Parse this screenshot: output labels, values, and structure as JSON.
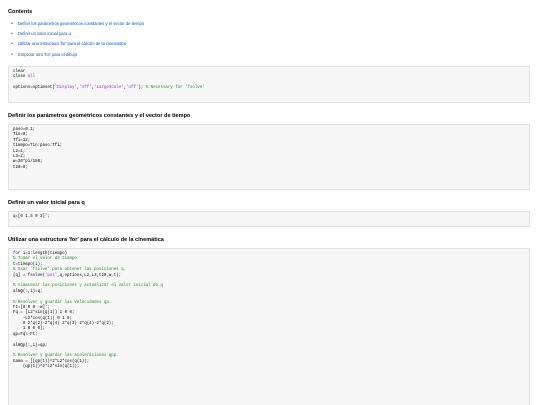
{
  "contents": {
    "title": "Contents",
    "items": [
      "Definir los parámetros geométricos constantes y el vector de tiempo",
      "Definir un valor inicial para q",
      "Utilizar una estructura 'for' para el cálculo de la cinemática",
      "Empezar otro 'for' para el dibujo"
    ]
  },
  "block1": {
    "lines": [
      [
        {
          "t": "clear",
          "c": ""
        }
      ],
      [
        {
          "t": "close ",
          "c": ""
        },
        {
          "t": "all",
          "c": "str"
        }
      ],
      [],
      [
        {
          "t": "options=optimset(",
          "c": ""
        },
        {
          "t": "'Display'",
          "c": "str"
        },
        {
          "t": ",",
          "c": ""
        },
        {
          "t": "'off'",
          "c": "str"
        },
        {
          "t": ",",
          "c": ""
        },
        {
          "t": "'LargeScale'",
          "c": "str"
        },
        {
          "t": ",",
          "c": ""
        },
        {
          "t": "'off'",
          "c": "str"
        },
        {
          "t": "); ",
          "c": ""
        },
        {
          "t": "% Necessary for 'fsolve'",
          "c": "cm"
        }
      ]
    ]
  },
  "section2": {
    "title": "Definir los parámetros geométricos constantes y el vector de tiempo",
    "lines": [
      [
        {
          "t": "paso=0.1;",
          "c": ""
        }
      ],
      [
        {
          "t": "Tin=0;",
          "c": ""
        }
      ],
      [
        {
          "t": "Tfi=12;",
          "c": ""
        }
      ],
      [
        {
          "t": "tiempo=Tin:paso:Tfi;",
          "c": ""
        }
      ],
      [
        {
          "t": "L2=1;",
          "c": ""
        }
      ],
      [
        {
          "t": "L3=2;",
          "c": ""
        }
      ],
      [
        {
          "t": "w=30*pi/180;",
          "c": ""
        }
      ],
      [
        {
          "t": "t20=0;",
          "c": ""
        }
      ]
    ]
  },
  "section3": {
    "title": "Definir un valor inicial para q",
    "lines": [
      [
        {
          "t": "q=[0 1.5 0 3]';",
          "c": ""
        }
      ]
    ]
  },
  "section4": {
    "title": "Utilizar una estructura 'for' para el cálculo de la cinemática",
    "lines": [
      [
        {
          "t": "for",
          "c": "kw"
        },
        {
          "t": " i=1:length(tiempo)",
          "c": ""
        }
      ],
      [
        {
          "t": "% Tomar el valor de tiempo",
          "c": "cm"
        }
      ],
      [
        {
          "t": "t=tiempo(i);",
          "c": ""
        }
      ],
      [
        {
          "t": "% Usar 'fsolve' para obtener las posiciones q.",
          "c": "cm"
        }
      ],
      [
        {
          "t": "[q] = fsolve(",
          "c": ""
        },
        {
          "t": "'pos'",
          "c": "str"
        },
        {
          "t": ",q,options,L2,L3,t20,w,t);",
          "c": ""
        }
      ],
      [],
      [
        {
          "t": "% Almacenar las posiciones y actualizar el valor inicial de q",
          "c": "cm"
        }
      ],
      [
        {
          "t": "almQ(:,i)=q;",
          "c": ""
        }
      ],
      [],
      [
        {
          "t": "% Resolver y guardar las velocidades qp",
          "c": "cm"
        }
      ],
      [
        {
          "t": "Ft=[0 0 0 -w]';",
          "c": ""
        }
      ],
      [
        {
          "t": "Fq = [L2*sin(q(1)) 1 0 0;",
          "c": ""
        }
      ],
      [
        {
          "t": "    -L2*cos(q(1)) 0 1 0;",
          "c": ""
        }
      ],
      [
        {
          "t": "    0 2*q(2)-2*q(4) 2*q(3) 2*q(4)-2*q(2);",
          "c": ""
        }
      ],
      [
        {
          "t": "    1 0 0 0];",
          "c": ""
        }
      ],
      [
        {
          "t": "qp=Fq\\-Ft;",
          "c": ""
        }
      ],
      [],
      [
        {
          "t": "almQp(:,i)=qp;",
          "c": ""
        }
      ],
      [],
      [
        {
          "t": "% Resolver y guardar las aceleraciones qpp",
          "c": "cm"
        }
      ],
      [
        {
          "t": "Gama = [(qp(1))^2*L2*cos(q(1));",
          "c": ""
        }
      ],
      [
        {
          "t": "    (qp(1))^2*L2*sin(q(1));",
          "c": ""
        }
      ]
    ]
  }
}
